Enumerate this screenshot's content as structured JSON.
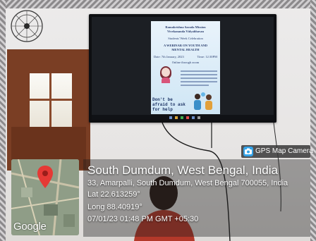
{
  "camera_app": {
    "badge_label": "GPS Map Camera",
    "badge_icon": "camera-map-icon",
    "accent_color": "#35a3e8"
  },
  "location": {
    "place": "South Dumdum, West Bengal, India",
    "address": "33, Amarpalli, South Dumdum, West Bengal 700055, India",
    "latitude": "Lat 22.613259°",
    "longitude": "Long 88.40919°",
    "timestamp": "07/01/23 01:48 PM GMT +05:30"
  },
  "map_thumbnail": {
    "watermark": "Google",
    "pin_icon": "location-pin-icon",
    "pin_color": "#e53935"
  },
  "poster": {
    "lines": [
      "Ramakrishna Sarada Mission",
      "Vivekananda Vidyabhavan",
      "Students' Week Celebration",
      "A WEBINAR ON YOUTH AND",
      "MENTAL HEALTH",
      "Date: 7th January, 2023",
      "Time: 12:30PM",
      "Online through zoom"
    ],
    "slogan": "Don't be afraid to ask for help"
  }
}
